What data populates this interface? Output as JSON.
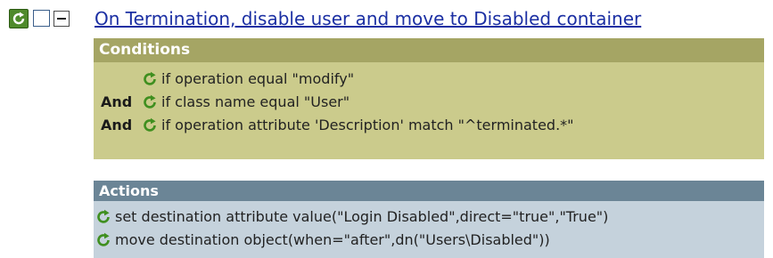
{
  "rule": {
    "title": "On Termination, disable user and move to Disabled container",
    "enabled_icon": "refresh-enabled-icon",
    "checkbox_checked": false,
    "collapse_state": "expanded"
  },
  "conditions": {
    "header": "Conditions",
    "rows": [
      {
        "connector": "",
        "text": "if operation equal \"modify\""
      },
      {
        "connector": "And",
        "text": "if class name equal \"User\""
      },
      {
        "connector": "And",
        "text": "if operation attribute 'Description' match \"^terminated.*\""
      }
    ]
  },
  "actions": {
    "header": "Actions",
    "rows": [
      {
        "text": "set destination attribute value(\"Login Disabled\",direct=\"true\",\"True\")"
      },
      {
        "text": "move destination object(when=\"after\",dn(\"Users\\Disabled\"))"
      }
    ]
  },
  "colors": {
    "title_link": "#1b2fa3",
    "conditions_header": "#a5a564",
    "conditions_body": "#cbcb8c",
    "actions_header": "#6b8596",
    "actions_body": "#c5d2dc",
    "icon_green": "#3f8f1f"
  }
}
